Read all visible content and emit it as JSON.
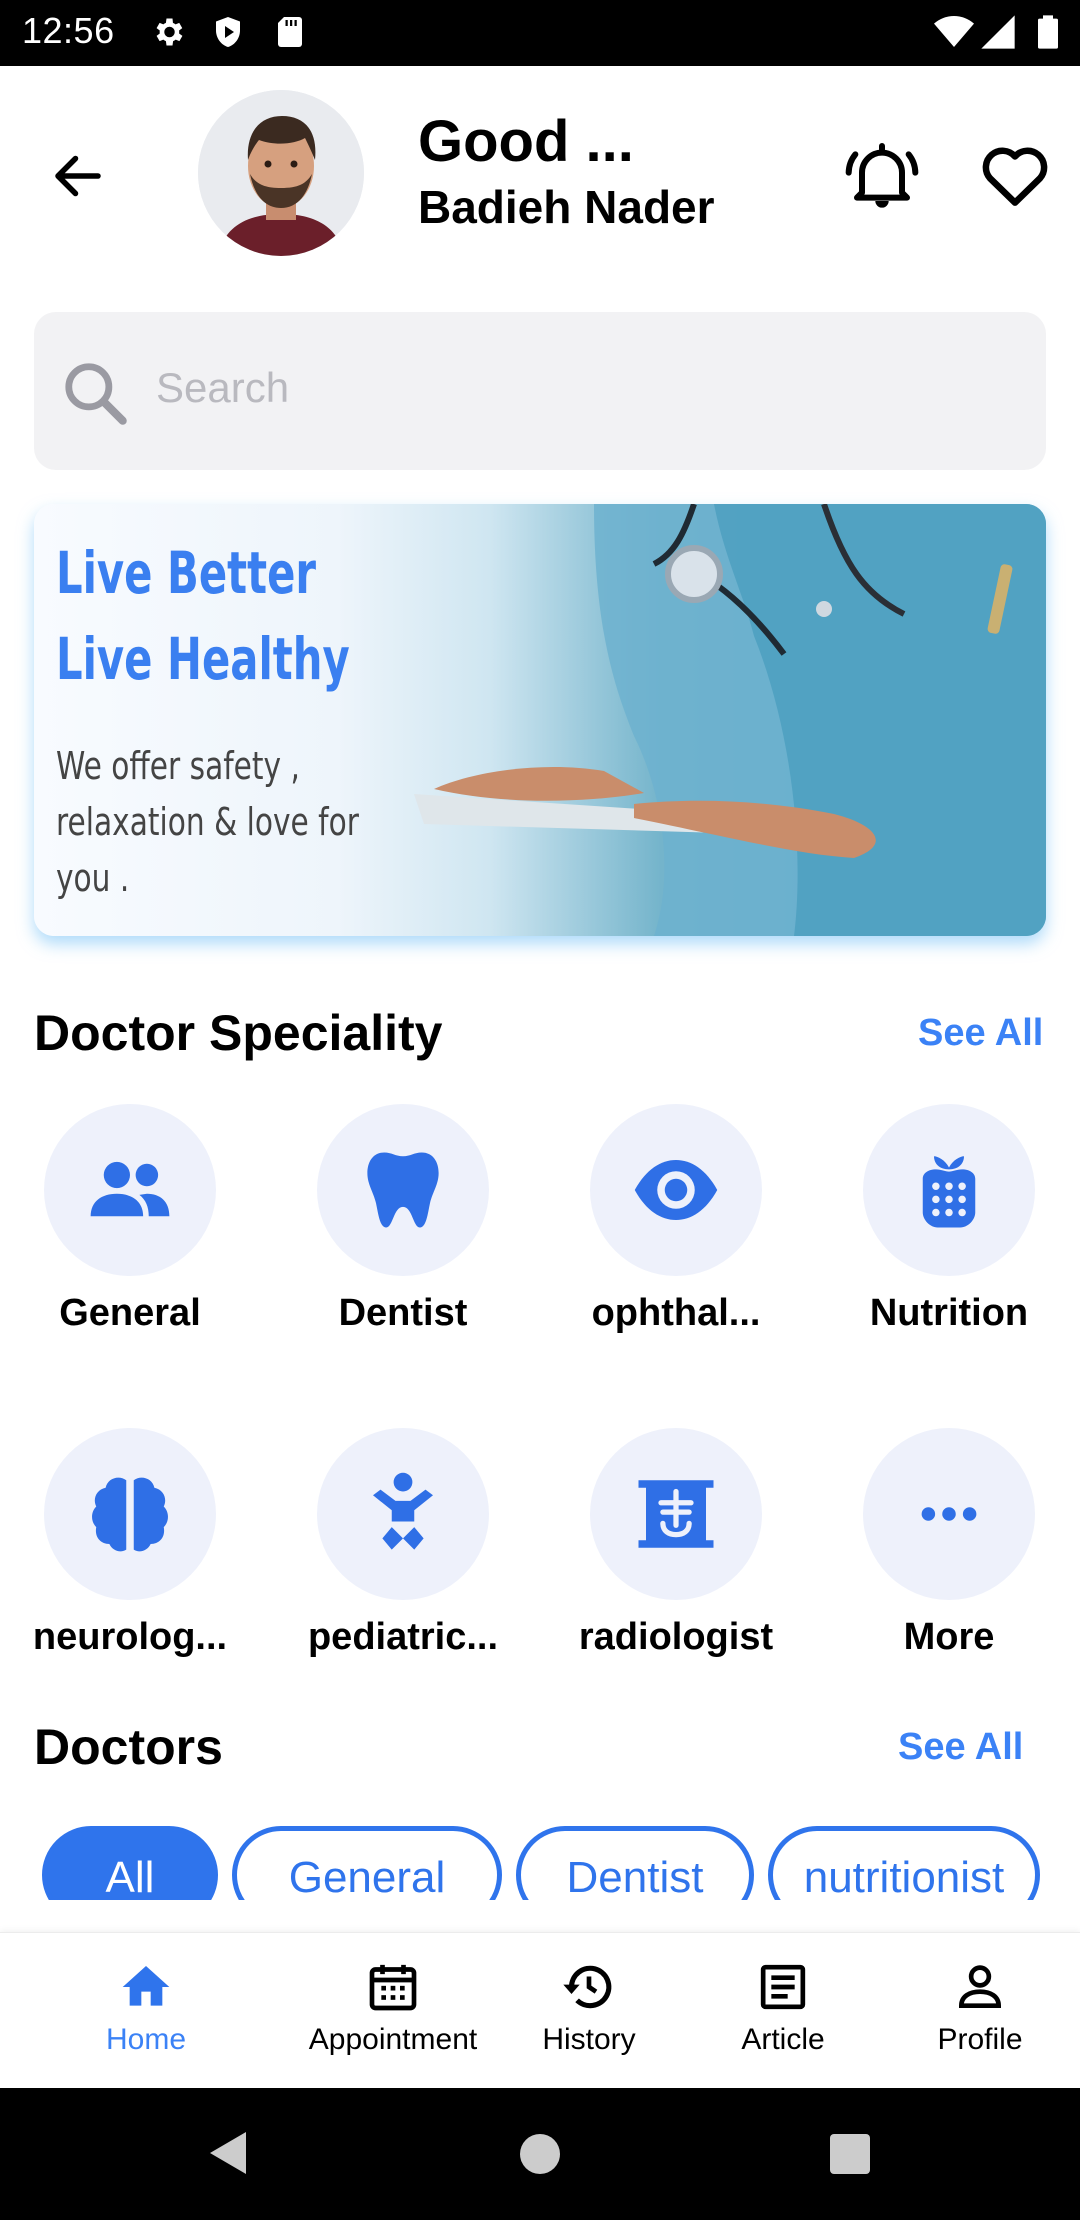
{
  "status_bar": {
    "time": "12:56"
  },
  "header": {
    "greeting": "Good ...",
    "user_name": "Badieh Nader"
  },
  "search": {
    "placeholder": "Search"
  },
  "banner": {
    "title": "Live Better Live Healthy",
    "subtitle": "We offer safety , relaxation & love for you ."
  },
  "speciality": {
    "title": "Doctor Speciality",
    "see_all": "See All",
    "items": [
      {
        "label": "General",
        "icon": "people-icon"
      },
      {
        "label": "Dentist",
        "icon": "tooth-icon"
      },
      {
        "label": "ophthal...",
        "icon": "eye-icon"
      },
      {
        "label": "Nutrition",
        "icon": "nutrition-icon"
      },
      {
        "label": "neurolog...",
        "icon": "brain-icon"
      },
      {
        "label": "pediatric...",
        "icon": "baby-icon"
      },
      {
        "label": "radiologist",
        "icon": "xray-icon"
      },
      {
        "label": "More",
        "icon": "more-dots-icon"
      }
    ]
  },
  "doctors": {
    "title": "Doctors",
    "see_all": "See All",
    "filters": [
      "All",
      "General",
      "Dentist",
      "nutritionist"
    ],
    "active_filter": "All"
  },
  "bottom_nav": {
    "items": [
      {
        "label": "Home",
        "icon": "home-icon"
      },
      {
        "label": "Appointment",
        "icon": "calendar-icon"
      },
      {
        "label": "History",
        "icon": "history-icon"
      },
      {
        "label": "Article",
        "icon": "article-icon"
      },
      {
        "label": "Profile",
        "icon": "person-icon"
      }
    ],
    "active": "Home"
  },
  "colors": {
    "accent": "#3b82f6",
    "chip_blue": "#2f74ec",
    "icon_bg": "#eef1fb",
    "search_bg": "#f2f2f4"
  }
}
